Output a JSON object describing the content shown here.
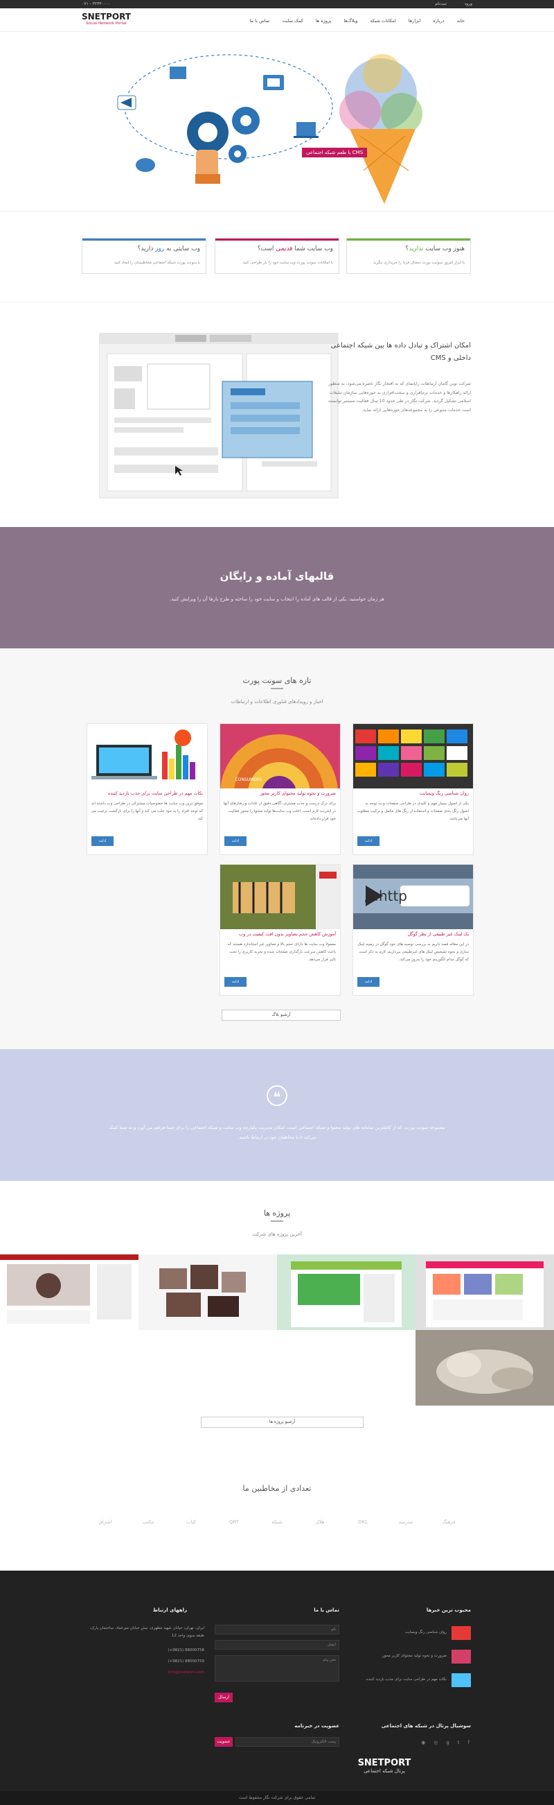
{
  "topbar": {
    "phone": "۰۷۱ - ۳۲۳۳۰۰۰۰",
    "login_label": "ورود",
    "register_label": "ثبت‌نام"
  },
  "header": {
    "logo_main": "SNETPORT",
    "logo_sub": "Social Network Portal"
  },
  "nav": [
    "خانه",
    "درباره",
    "ابزارها",
    "امکانات شبکه",
    "وبلاگ‌ها",
    "پروژه ها",
    "کمک سایت",
    "تماس با ما"
  ],
  "hero": {
    "tag_label": "CMS با طعم شبکه اجتماعی"
  },
  "features": [
    {
      "title_prefix": "هنوز وب سایت ",
      "title_hl": "ندارید",
      "title_suffix": "؟",
      "desc": "با ابزار امروز سوئیت پورت دیجتال فردا را خریداری بنگرید",
      "color": "#6db33f"
    },
    {
      "title_prefix": "وب سایت شما ",
      "title_hl": "قدیمی",
      "title_suffix": " است؟",
      "desc": "با امکانات سونت پورت وب سایت خود را باز طراحی کنید",
      "color": "#c2185b"
    },
    {
      "title_prefix": "وب سایتی به ",
      "title_hl": "روز",
      "title_suffix": " دارید؟",
      "desc": "با سونت پورت شبکه اجتماعی مخاطبینتان را ایجاد کنید",
      "color": "#3a7fc1"
    }
  ],
  "intro": {
    "title": "امکان اشتراک و تبادل داده ها بین شبکه اجتماعی داخلی و CMS",
    "body": "شرکت نوین گامان ارتباطات رایانمای که به افتخار نگار ناصره می‌شود، به منظور ارائه راهکارها و خدمات نرم‌افزاری و سخت‌افزاری به حوزه‌هایی سازمان تبلیغات اسلامی تشکیل گردید. شرکت نگار در طی حدود 10 سال فعالیت مستمر توانسته است خدمات متنوعی را به مجموعه‌های حوزه‌هایی ارائه نماید."
  },
  "banner": {
    "title": "قالبهای آماده و رایگان",
    "text": "هر زمان خواستید، یکی از قالب های آماده را انتخاب و سایت خود را ساخته و طرح بارها آن را ویرایش کنید."
  },
  "news": {
    "title": "تازه های سونت پورت",
    "subtitle": "اخبار و رویدادهای فناوری اطلاعات و ارتباطات",
    "more_label": "ادامه",
    "archive_label": "آرشیو بلاگ",
    "cards": [
      {
        "title": "روان شناسی رنگ وبسایت",
        "desc": "یکی از اصول بسیار مهم و کلیدی در طراحی صفحات وب، توجه به اصول رنگ‌ بندی صفحات و استفاده از رنگ های مکمل و ترکیب مطلوب آنها می‌باشد."
      },
      {
        "title": "ضرورت و نحوه تولید محتوای کاربر محور",
        "desc": "برای درک درست و جذب مشتری، آگاهی دقیق از عادات و رفتارهای آنها در اینترنت لازم است. اغلب وب سایت‌ها تولید محتوا را محور فعالیت خود قرار داده‌اند."
      },
      {
        "title": "نکات مهم در طراحی سایت برای جذب بازدید کننده",
        "desc": "موفق ترین وب سایت ها خصوصیات مشترکی در طراحی وب داشته اند که توجه افراد را به خود جلب می کند و آنها را برای بازگشت ترغیب می کند."
      },
      {
        "title": "یک لینک غیر طبیعی از نظر گوگل",
        "desc": "در این مقاله قصد داریم به بررسی توصیه های خود گوگل در زمینه لینک سازی و نحوه تشخیص لینک های غیرطبیعی بپردازیم. لازم به ذکر است که گوگل مدام الگوریتم خود را به‌روز می‌کند."
      },
      {
        "title": "آموزش کاهش حجم تصاویر بدون افت کیفیت در وب",
        "desc": "معمولا وب سایت ها دارای حجم بالا و تصاویر غیر استاندارد هستند که باعث کاهش سرعت بارگذاری صفحات شده و تجربه کاربری را تحت تاثیر قرار می‌دهد."
      }
    ]
  },
  "quote": {
    "text": "مجموعه سونت پورت، که از کاملترین سامانه های تولید محتوا و شبکه اجتماعی است، امکان مدیریت یکپارچه وب سایت و شبکه اجتماعی را برای شما فراهم می آورد و به شما کمک می‌کند تا با مخاطبان خود در ارتباط باشید."
  },
  "projects": {
    "title": "پروژه ها",
    "subtitle": "آخرین پروژه های شرکت",
    "archive_label": "آرشیو پروژه ها"
  },
  "clients": {
    "title": "تعدادی از مخاطبین ما",
    "names": [
      "فرهنگ",
      "مدرسه",
      "OKL",
      "هلال",
      "شبکه",
      "QRT",
      "کتاب",
      "مکتب",
      "اشراق",
      "سمنه"
    ]
  },
  "footer": {
    "popular_title": "محبوب ترین خبرها",
    "popular": [
      "روان شناسی رنگ وبسایت",
      "ضرورت و نحوه تولید محتوای کاربر محور",
      "نکات مهم در طراحی سایت برای جذب بازدید کننده"
    ],
    "contact_title": "تماس با ما",
    "name_ph": "نام",
    "email_ph": "ایمیل",
    "msg_ph": "متن پیام",
    "send_label": "ارسال",
    "links_title": "راههای ارتباط",
    "address": "ایران، تهران، خیابان شهید مطهری، نبش خیابان میرعماد، ساختمان پارک، طبقه سوم، واحد 12",
    "tel": "(+9821) 88000758",
    "fax": "(+9821) 88000759",
    "email": "info@snetport.com",
    "social_title": "سوشیال پرتال در شبکه های اجتماعی",
    "newsletter_title": "عضویت در خبرنامه",
    "newsletter_ph": "پست الکترونیک",
    "newsletter_btn": "عضویت",
    "logo_main": "SNETPORT",
    "logo_sub": "پرتال شبکه اجتماعی",
    "copyright": "تمامی حقوق برای شرکت نگار محفوظ است"
  },
  "colors": {
    "accent": "#c2185b",
    "green": "#6db33f",
    "blue": "#3a7fc1",
    "banner": "#8a7489",
    "quote": "#c9d0e8"
  }
}
